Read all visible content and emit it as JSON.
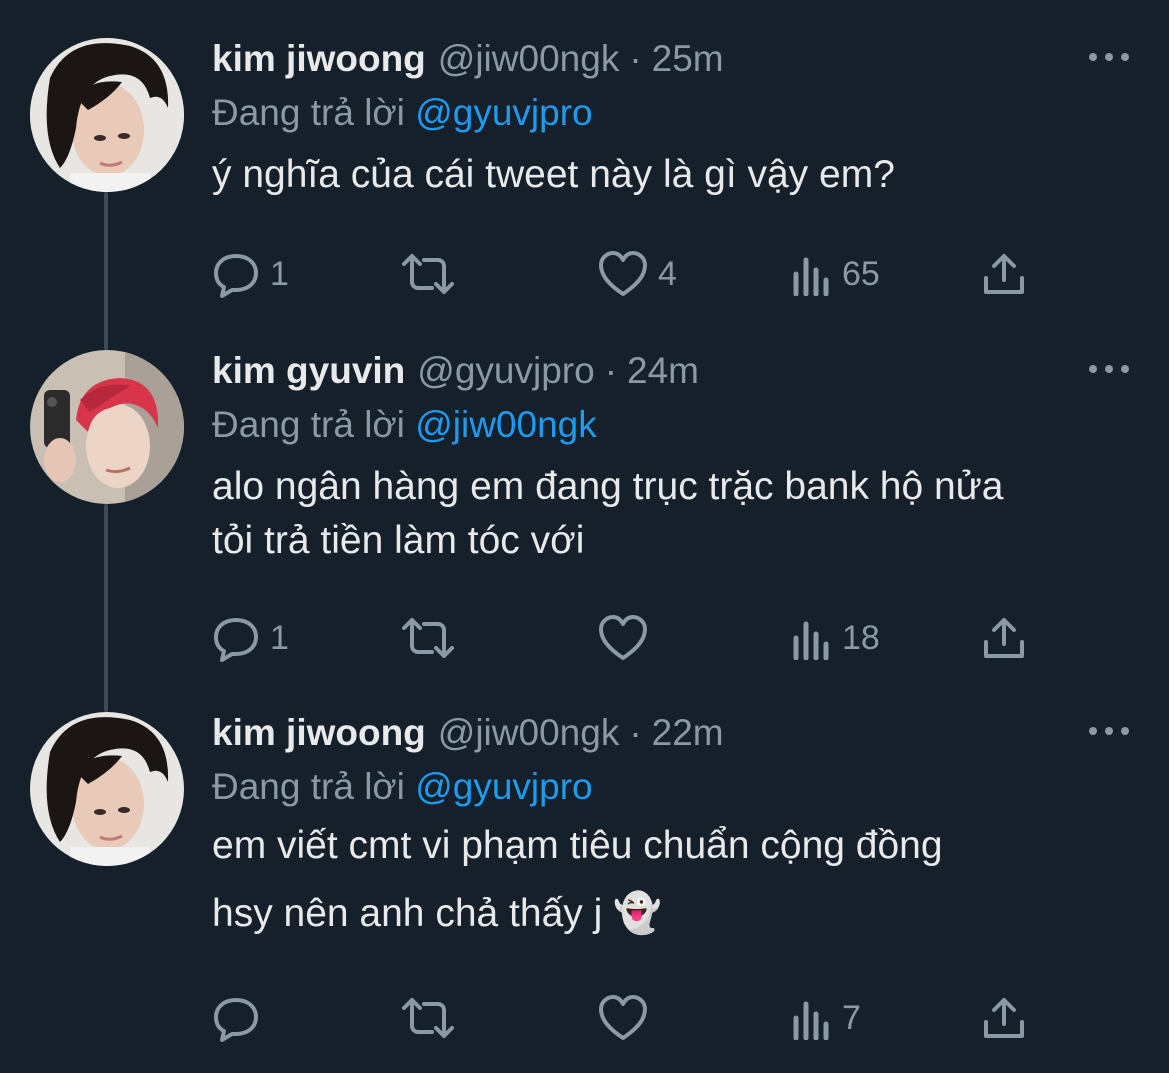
{
  "tweets": [
    {
      "name": "kim jiwoong",
      "handle": "@jiw00ngk",
      "dot": "·",
      "time": "25m",
      "reply_prefix": "Đang trả lời",
      "reply_to": "@gyuvjpro",
      "lines": [
        "ý nghĩa của cái tweet này là gì vậy em?"
      ],
      "replies": "1",
      "retweets": "",
      "likes": "4",
      "views": "65",
      "avatar": "dark-hair"
    },
    {
      "name": "kim gyuvin",
      "handle": "@gyuvjpro",
      "dot": "·",
      "time": "24m",
      "reply_prefix": "Đang trả lời",
      "reply_to": "@jiw00ngk",
      "lines": [
        "alo ngân hàng em đang trục trặc bank hộ nửa",
        "tỏi trả tiền làm tóc với"
      ],
      "replies": "1",
      "retweets": "",
      "likes": "",
      "views": "18",
      "avatar": "red-hair"
    },
    {
      "name": "kim jiwoong",
      "handle": "@jiw00ngk",
      "dot": "·",
      "time": "22m",
      "reply_prefix": "Đang trả lời",
      "reply_to": "@gyuvjpro",
      "lines": [
        "em viết cmt vi phạm tiêu chuẩn cộng đồng",
        "hsy nên anh chả thấy j 👻"
      ],
      "replies": "",
      "retweets": "",
      "likes": "",
      "views": "7",
      "avatar": "dark-hair"
    }
  ],
  "icons": {
    "reply": "reply-icon",
    "retweet": "retweet-icon",
    "like": "heart-icon",
    "views": "views-icon",
    "share": "share-icon",
    "more": "more-icon"
  },
  "colors": {
    "background": "#15202b",
    "text": "#e7e9ea",
    "muted": "#8b98a5",
    "mention": "#1d9bf0",
    "thread_line": "#3d4b59"
  }
}
